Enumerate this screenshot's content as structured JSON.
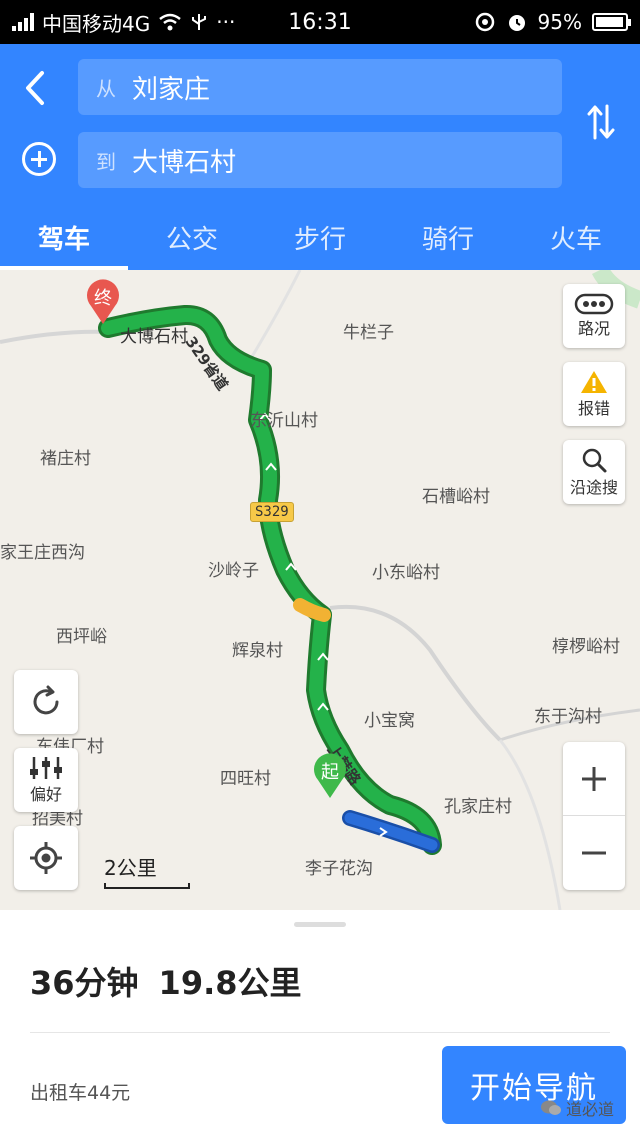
{
  "status_bar": {
    "carrier": "中国移动4G",
    "time": "16:31",
    "battery": "95%",
    "battery_level": 0.95
  },
  "header": {
    "from_prefix": "从",
    "from_value": "刘家庄",
    "to_prefix": "到",
    "to_value": "大博石村",
    "tabs": [
      {
        "label": "驾车",
        "active": true
      },
      {
        "label": "公交",
        "active": false
      },
      {
        "label": "步行",
        "active": false
      },
      {
        "label": "骑行",
        "active": false
      },
      {
        "label": "火车",
        "active": false
      }
    ]
  },
  "map": {
    "places": [
      "大博石村",
      "牛栏子",
      "东沂山村",
      "褚庄村",
      "石槽峪村",
      "家王庄西沟",
      "沙岭子",
      "小东峪村",
      "西坪峪",
      "辉泉村",
      "椁椤峪村",
      "东伟厂村",
      "小宝窝",
      "东于沟村",
      "四旺村",
      "孔家庄村",
      "招美村",
      "李子花沟"
    ],
    "road_shield": "S329",
    "route_labels": [
      "329省道",
      "上韩路"
    ],
    "end_marker": "终",
    "start_marker": "起",
    "buttons": {
      "traffic": "路况",
      "report": "报错",
      "search_along": "沿途搜",
      "preference": "偏好"
    },
    "scale": "2公里"
  },
  "route_summary": {
    "duration": "36分钟",
    "distance": "19.8公里",
    "taxi_fare": "出租车44元",
    "start_nav": "开始导航"
  },
  "watermark": "道必道",
  "colors": {
    "primary_blue": "#3385ff",
    "route_green": "#24b24a",
    "route_yellow": "#f2b233",
    "route_blue": "#2a6dd9",
    "pin_red": "#e8574f",
    "pin_green": "#3fb94a"
  }
}
